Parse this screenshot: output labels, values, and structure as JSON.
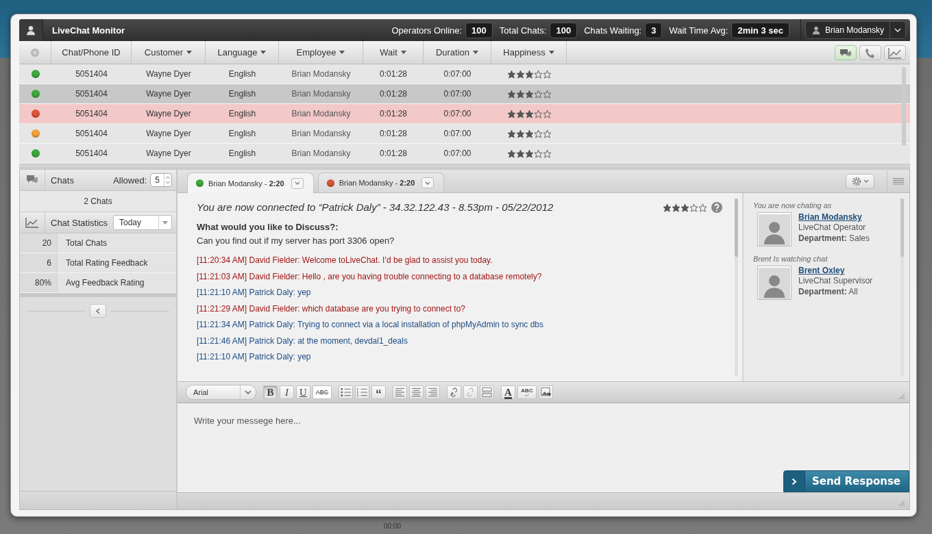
{
  "header": {
    "title": "LiveChat Monitor",
    "stats": [
      {
        "label": "Operators Online:",
        "value": "100"
      },
      {
        "label": "Total Chats:",
        "value": "100"
      },
      {
        "label": "Chats Waiting:",
        "value": "3"
      },
      {
        "label": "Wait Time Avg:",
        "value": "2min 3 sec"
      }
    ],
    "user": "Brian Modansky"
  },
  "table": {
    "columns": [
      {
        "label": "Chat/Phone ID",
        "sortable": false
      },
      {
        "label": "Customer",
        "sortable": true
      },
      {
        "label": "Language",
        "sortable": true
      },
      {
        "label": "Employee",
        "sortable": true
      },
      {
        "label": "Wait",
        "sortable": true
      },
      {
        "label": "Duration",
        "sortable": true
      },
      {
        "label": "Happiness",
        "sortable": true
      }
    ],
    "view_buttons": [
      {
        "kind": "chat",
        "selected": true
      },
      {
        "kind": "phone",
        "selected": false
      },
      {
        "kind": "chart",
        "selected": false
      }
    ],
    "rows": [
      {
        "color": "#3daa3d",
        "id": "5051404",
        "customer": "Wayne Dyer",
        "language": "English",
        "employee": "Brian Modansky",
        "wait": "0:01:28",
        "duration": "0:07:00",
        "stars": 3,
        "selected": false,
        "alert": false
      },
      {
        "color": "#3daa3d",
        "id": "5051404",
        "customer": "Wayne Dyer",
        "language": "English",
        "employee": "Brian Modansky",
        "wait": "0:01:28",
        "duration": "0:07:00",
        "stars": 3,
        "selected": true,
        "alert": false
      },
      {
        "color": "#dd5538",
        "id": "5051404",
        "customer": "Wayne Dyer",
        "language": "English",
        "employee": "Brian Modansky",
        "wait": "0:01:28",
        "duration": "0:07:00",
        "stars": 3,
        "selected": false,
        "alert": true
      },
      {
        "color": "#f5a23a",
        "id": "5051404",
        "customer": "Wayne Dyer",
        "language": "English",
        "employee": "Brian Modansky",
        "wait": "0:01:28",
        "duration": "0:07:00",
        "stars": 3,
        "selected": false,
        "alert": false
      },
      {
        "color": "#3daa3d",
        "id": "5051404",
        "customer": "Wayne Dyer",
        "language": "English",
        "employee": "Brian Modansky",
        "wait": "0:01:28",
        "duration": "0:07:00",
        "stars": 3,
        "selected": false,
        "alert": false
      }
    ]
  },
  "sidebar": {
    "chats": {
      "title": "Chats",
      "allowed_label": "Allowed:",
      "allowed_value": "5",
      "count": "2 Chats"
    },
    "statistics": {
      "title": "Chat Statistics",
      "period": "Today",
      "rows": [
        {
          "value": "20",
          "label": "Total Chats"
        },
        {
          "value": "6",
          "label": "Total Rating Feedback"
        },
        {
          "value": "80%",
          "label": "Avg Feedback Rating"
        }
      ]
    }
  },
  "chat": {
    "tabs": [
      {
        "label": "Brian Modansky - **2:20**",
        "color": "#3daa3d",
        "selected": true
      },
      {
        "label": "Brian Modansky - **2:20**",
        "color": "#dd5538",
        "selected": false
      }
    ],
    "connected": "You are now connected to “Patrick Daly” - 34.32.122.43 - 8.53pm - 05/22/2012",
    "stars": 3,
    "question_title": "What would you like to Discuss?:",
    "question": "Can you find out if my server has port 3306 open?",
    "messages": [
      {
        "kind": "operator",
        "text": "[11:20:34 AM] David Fielder: Welcome toLiveChat.  I’d be glad to assist you today."
      },
      {
        "kind": "operator",
        "text": "[11:21:03 AM] David Fielder: Hello , are you having trouble connecting to a database remotely?"
      },
      {
        "kind": "customer",
        "text": "[11:21:10 AM] Patrick Daly: yep"
      },
      {
        "kind": "operator",
        "text": "[11:21:29 AM] David Fielder: which database are you trying to connect to?"
      },
      {
        "kind": "customer",
        "text": "[11:21:34 AM] Patrick Daly: Trying to connect via a local installation of phpMyAdmin to sync dbs"
      },
      {
        "kind": "customer",
        "text": "[11:21:46 AM] Patrick Daly: at the moment, devdal1_deals"
      },
      {
        "kind": "customer",
        "text": "[11:21:10 AM] Patrick Daly: yep"
      }
    ],
    "participants": [
      {
        "caption": "You are now chating as",
        "name": "Brian Modansky",
        "role": "LiveChat Operator",
        "department": "**Department:**  Sales"
      },
      {
        "caption": "Brent Is watching chat",
        "name": "Brent Oxley",
        "role": "LiveChat Supervisor",
        "department": "**Department:**  All"
      }
    ],
    "editor": {
      "font": "Arial",
      "toolbar_groups": [
        {
          "buttons": [
            {
              "kind": "bold",
              "label": "B",
              "on": true
            },
            {
              "kind": "italic",
              "label": "I",
              "on": false
            },
            {
              "kind": "underline",
              "label": "U",
              "on": false
            },
            {
              "kind": "strike",
              "label": "ABC",
              "on": false
            }
          ]
        },
        {
          "buttons": [
            {
              "kind": "bullets",
              "on": false
            },
            {
              "kind": "numbers",
              "on": false
            },
            {
              "kind": "quote",
              "label": "“",
              "on": false
            }
          ]
        },
        {
          "buttons": [
            {
              "kind": "align-left",
              "on": false
            },
            {
              "kind": "align-center",
              "on": false
            },
            {
              "kind": "align-right",
              "on": false
            }
          ]
        },
        {
          "buttons": [
            {
              "kind": "link",
              "on": false
            },
            {
              "kind": "unlink",
              "on": false
            },
            {
              "kind": "rule",
              "on": false
            }
          ]
        },
        {
          "buttons": [
            {
              "kind": "text-color",
              "label": "A",
              "on": false
            },
            {
              "kind": "spellcheck",
              "label": "ABC",
              "on": false
            },
            {
              "kind": "image",
              "on": false
            }
          ]
        }
      ],
      "placeholder": "Write your messege here...",
      "send": "Send Response"
    }
  },
  "background": {
    "time_label": "00:00"
  }
}
